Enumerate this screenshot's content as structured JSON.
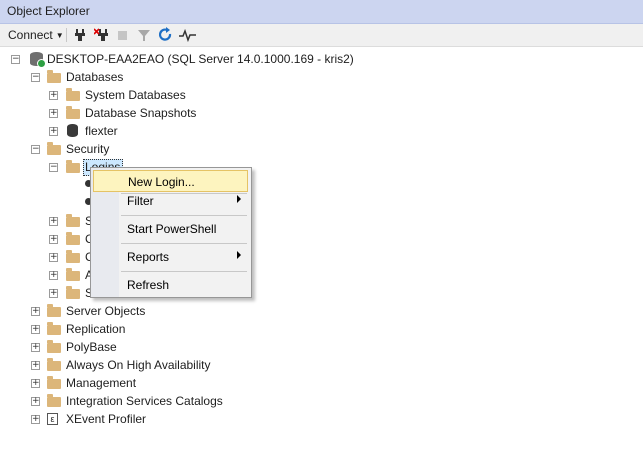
{
  "window": {
    "title": "Object Explorer"
  },
  "toolbar": {
    "connect_label": "Connect",
    "icons": [
      "connect-plug-icon",
      "disconnect-icon",
      "stop-icon",
      "filter-icon",
      "refresh-icon",
      "activity-monitor-icon"
    ]
  },
  "tree": {
    "server": "DESKTOP-EAA2EAO (SQL Server 14.0.1000.169 - kris2)",
    "databases": "Databases",
    "system_databases": "System Databases",
    "database_snapshots": "Database Snapshots",
    "flexter": "flexter",
    "security": "Security",
    "logins": "Logins",
    "partial": [
      "S",
      "C",
      "C",
      "A",
      "S"
    ],
    "server_objects": "Server Objects",
    "replication": "Replication",
    "polybase": "PolyBase",
    "always_on": "Always On High Availability",
    "management": "Management",
    "integration_services": "Integration Services Catalogs",
    "xevent_profiler": "XEvent Profiler"
  },
  "context_menu": {
    "new_login": "New Login...",
    "filter": "Filter",
    "start_powershell": "Start PowerShell",
    "reports": "Reports",
    "refresh": "Refresh"
  }
}
